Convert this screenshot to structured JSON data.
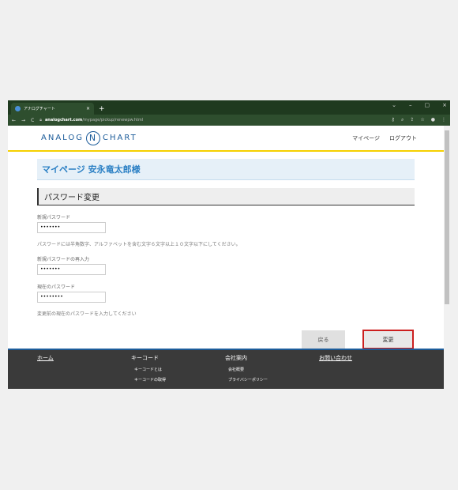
{
  "browser": {
    "tab_title": "アナログチャート",
    "tab_close": "×",
    "new_tab": "+",
    "url_domain": "analogchart.com",
    "url_path": "/mypage/pickup/renewpw.html",
    "controls": [
      "⌄",
      "–",
      "▢",
      "×"
    ],
    "nav": [
      "←",
      "→",
      "C"
    ]
  },
  "header": {
    "logo_left": "ANALOG",
    "logo_mark": "N",
    "logo_right": "CHART",
    "nav": [
      "マイページ",
      "ログアウト"
    ]
  },
  "main": {
    "mypage_title": "マイページ 安永竜太郎様",
    "section_title": "パスワード変更",
    "fields": [
      {
        "label": "新規パスワード",
        "value": "•••••••"
      },
      {
        "label": "新規パスワードの再入力",
        "value": "•••••••"
      },
      {
        "label": "現在のパスワード",
        "value": "••••••••"
      }
    ],
    "pw_hint": "パスワードには半角数字、アルファベットを含む文字６文字以上１０文字以下にしてください。",
    "current_hint": "変更前の現在のパスワードを入力してください",
    "back_label": "戻る",
    "submit_label": "変更"
  },
  "footer": {
    "cols": [
      {
        "head": "ホーム",
        "subs": []
      },
      {
        "head": "キーコード",
        "subs": [
          "キーコードとは",
          "キーコードの取得"
        ]
      },
      {
        "head": "会社案内",
        "subs": [
          "会社概要",
          "プライバシーポリシー"
        ]
      },
      {
        "head": "お問い合わせ",
        "subs": []
      }
    ]
  }
}
